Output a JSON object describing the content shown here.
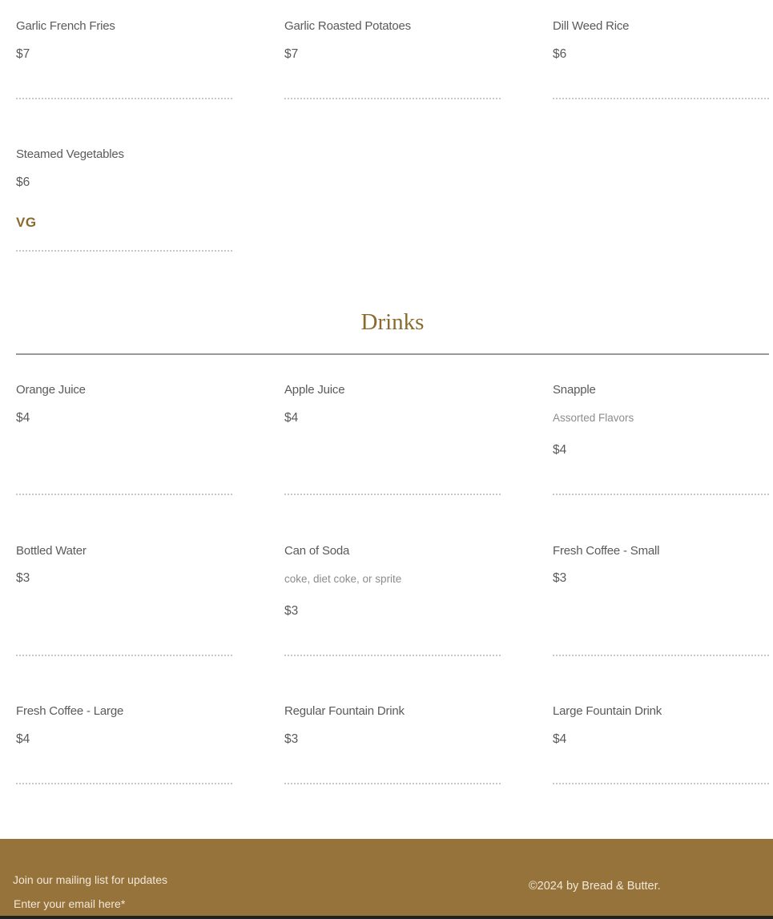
{
  "sides": {
    "items": [
      {
        "name": "Garlic French Fries",
        "price": "$7"
      },
      {
        "name": "Garlic Roasted Potatoes",
        "price": "$7"
      },
      {
        "name": "Dill Weed Rice",
        "price": "$6"
      },
      {
        "name": "Steamed Vegetables",
        "price": "$6",
        "tag": "VG"
      }
    ]
  },
  "drinks": {
    "title": "Drinks",
    "items": [
      {
        "name": "Orange Juice",
        "price": "$4"
      },
      {
        "name": "Apple Juice",
        "price": "$4"
      },
      {
        "name": "Snapple",
        "description": "Assorted Flavors",
        "price": "$4"
      },
      {
        "name": "Bottled Water",
        "price": "$3"
      },
      {
        "name": "Can of Soda",
        "description": "coke, diet coke, or sprite",
        "price": "$3"
      },
      {
        "name": "Fresh Coffee - Small",
        "price": "$3"
      },
      {
        "name": "Fresh Coffee - Large",
        "price": "$4"
      },
      {
        "name": "Regular Fountain Drink",
        "price": "$3"
      },
      {
        "name": "Large Fountain Drink",
        "price": "$4"
      }
    ]
  },
  "footer": {
    "mailing_label": "Join our mailing list for updates",
    "email_placeholder": "Enter your email here*",
    "copyright": "©2024 by Bread & Butter."
  },
  "colors": {
    "accent": "#8b6a2e",
    "footer_bg": "#96733b"
  }
}
